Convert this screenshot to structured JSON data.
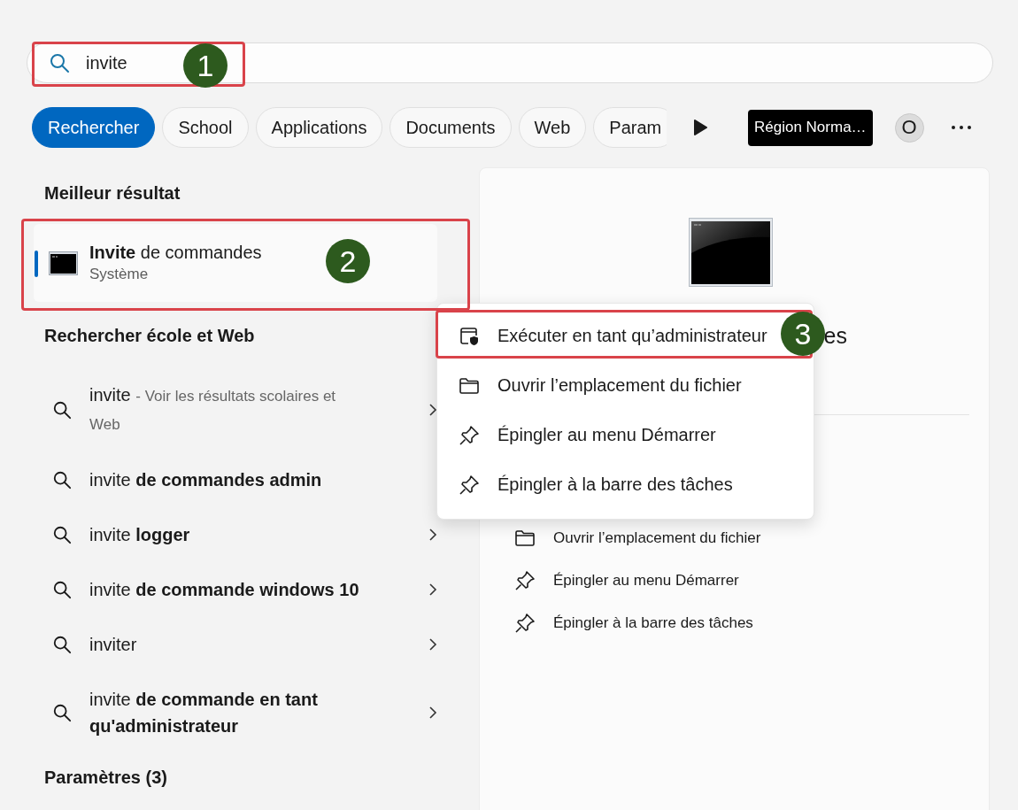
{
  "search": {
    "value": "invite"
  },
  "filters": [
    {
      "label": "Rechercher",
      "selected": true
    },
    {
      "label": "School",
      "selected": false
    },
    {
      "label": "Applications",
      "selected": false
    },
    {
      "label": "Documents",
      "selected": false
    },
    {
      "label": "Web",
      "selected": false
    },
    {
      "label": "Param",
      "selected": false
    }
  ],
  "region_badge": "Région Norma…",
  "account": "O",
  "best_match": {
    "header": "Meilleur résultat",
    "title": "**Invite** de commandes",
    "subtitle": "Système",
    "selected": true
  },
  "web_section": {
    "header": "Rechercher école et Web",
    "suggestions": [
      {
        "text": "invite",
        "hint": "- Voir les résultats scolaires et Web",
        "chevron": true
      },
      {
        "text": "invite **de commandes admin**",
        "chevron": false
      },
      {
        "text": "invite **logger**",
        "chevron": true
      },
      {
        "text": "invite **de commande windows 10**",
        "chevron": true
      },
      {
        "text": "inviter",
        "chevron": true
      },
      {
        "text": "invite **de commande en tant qu'administrateur**",
        "chevron": true
      }
    ]
  },
  "settings_header": "Paramètres (3)",
  "preview": {
    "title": "es",
    "actions": [
      {
        "kind": "folder",
        "label": "Ouvrir l’emplacement du fichier"
      },
      {
        "kind": "pin",
        "label": "Épingler au menu Démarrer"
      },
      {
        "kind": "pin",
        "label": "Épingler à la barre des tâches"
      }
    ]
  },
  "context_menu": {
    "items": [
      {
        "kind": "admin",
        "label": "Exécuter en tant qu’administrateur"
      },
      {
        "kind": "folder",
        "label": "Ouvrir l’emplacement du fichier"
      },
      {
        "kind": "pin",
        "label": "Épingler au menu Démarrer"
      },
      {
        "kind": "pin",
        "label": "Épingler à la barre des tâches"
      }
    ]
  },
  "annotations": [
    {
      "number": "1"
    },
    {
      "number": "2"
    },
    {
      "number": "3"
    }
  ]
}
